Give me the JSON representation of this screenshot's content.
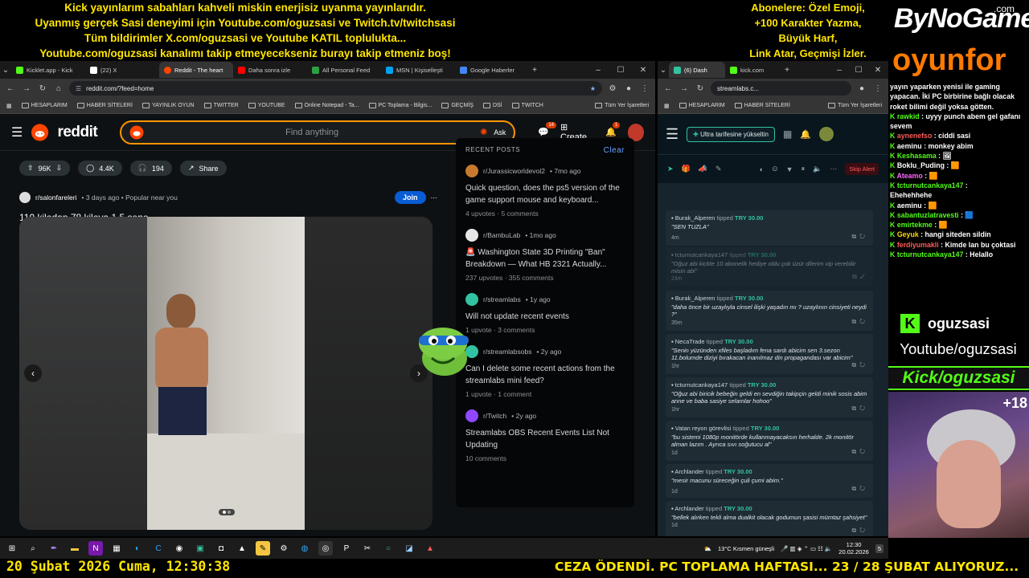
{
  "overlay": {
    "top_lines": [
      "Kick yayınlarım sabahları kahveli miskin enerjisiz uyanma yayınlarıdır.",
      "Uyanmış gerçek Sasi deneyimi için Youtube.com/oguzsasi ve Twitch.tv/twitchsasi",
      "Tüm bildirimler X.com/oguzsasi ve Youtube KATIL toplulukta...",
      "Youtube.com/oguzsasi kanalımı takip etmeyecekseniz burayı takip etmeniz boş!"
    ],
    "right_lines": [
      "Abonelere: Özel Emoji,",
      "+100 Karakter Yazma,",
      "Büyük Harf,",
      "Link Atar, Geçmişi İzler."
    ],
    "brand_top": "ByNoGame",
    "brand_com": ".com",
    "brand_bottom": "oyunfor",
    "kick_channel": "oguzsasi",
    "youtube_label": "Youtube/oguzsasi",
    "kick_label": "Kick/oguzsasi",
    "viewer_plus": "+18",
    "bottom_date": "20 Şubat 2026 Cuma, 12:30:38",
    "bottom_ticker": "CEZA ÖDENDİ. PC TOPLAMA HAFTASI... 23 / 28 ŞUBAT ALIYORUZ..."
  },
  "left_browser": {
    "tabs": [
      {
        "label": "Kicklet.app - Kick",
        "color": "#53fc18"
      },
      {
        "label": "(22) X",
        "color": "#ffffff"
      },
      {
        "label": "Reddit - The heart",
        "color": "#ff4500",
        "active": true
      },
      {
        "label": "Daha sonra izle",
        "color": "#ff0000"
      },
      {
        "label": "All Personal Feed",
        "color": "#2ea043"
      },
      {
        "label": "MSN | Kişiselleşti",
        "color": "#00a2ed"
      },
      {
        "label": "Google Haberler",
        "color": "#4285f4"
      }
    ],
    "url": "reddit.com/?feed=home",
    "bookmarks": [
      "HESAPLARIM",
      "HABER SİTELERİ",
      "YAYINLIK OYUN",
      "TWITTER",
      "YOUTUBE",
      "Online Notepad - Ta...",
      "PC Toplama - Bilgis...",
      "GEÇMİŞ",
      "DSİ",
      "TWITCH",
      "Tüm Yer İşaretleri"
    ]
  },
  "reddit": {
    "logo": "reddit",
    "search_placeholder": "Find anything",
    "ask": "Ask",
    "chat_badge": "14",
    "create": "Create",
    "notif_badge": "1",
    "vote_count": "96K",
    "comments": "4.4K",
    "awards": "194",
    "share": "Share",
    "subreddit": "r/salonfareleri",
    "post_meta": "• 3 days ago • Popular near you",
    "join": "Join",
    "post_title": "110 kilodan 78 kiloya 1.5 sene",
    "recent_header": "RECENT POSTS",
    "clear": "Clear",
    "recent_posts": [
      {
        "sub": "r/Jurassicworldevol2",
        "age": "• 7mo ago",
        "title": "Quick question, does the ps5 version of the game support mouse and keyboard...",
        "upvotes": "4 upvotes",
        "comments": "5 comments",
        "color": "#c77a2e"
      },
      {
        "sub": "r/BambuLab",
        "age": "• 1mo ago",
        "title": "🚨 Washington State 3D Printing \"Ban\" Breakdown — What HB 2321 Actually...",
        "upvotes": "237 upvotes",
        "comments": "355 comments",
        "color": "#e6e6e6"
      },
      {
        "sub": "r/streamlabs",
        "age": "• 1y ago",
        "title": "Will not update recent events",
        "upvotes": "1 upvote",
        "comments": "3 comments",
        "color": "#31c3a2"
      },
      {
        "sub": "r/streamlabsobs",
        "age": "• 2y ago",
        "title": "Can I delete some recent actions from the streamlabs mini feed?",
        "upvotes": "1 upvote",
        "comments": "1 comment",
        "color": "#31c3a2"
      },
      {
        "sub": "r/Twitch",
        "age": "• 2y ago",
        "title": "Streamlabs OBS Recent Events List Not Updating",
        "upvotes": "",
        "comments": "10 comments",
        "color": "#9146ff"
      }
    ]
  },
  "right_browser": {
    "tabs": [
      {
        "label": "(6) Dash",
        "color": "#31c3a2"
      },
      {
        "label": "kick.com",
        "color": "#53fc18"
      }
    ],
    "url": "streamlabs.c...",
    "bookmarks": [
      "HESAPLARIM",
      "HABER SİTELERİ",
      "Tüm Yer İşaretleri"
    ]
  },
  "streamlabs": {
    "upgrade": "Ultra tarifesine yükseltin",
    "skip_alert": "Skip Alert",
    "events": [
      {
        "name": "Burak_Alperen",
        "tipped": "tipped",
        "amount": "TRY 30.00",
        "msg": "\"SEN TUZLA\"",
        "ago": "4m",
        "dim": false
      },
      {
        "name": "tcturnutcankaya147",
        "tipped": "tipped",
        "amount": "TRY 30.00",
        "msg": "\"Oğuz abi kickte 10 abonelik hediye oldu çok üzür dilerim vip verebilir misin abi\"",
        "ago": "24m",
        "dim": true
      },
      {
        "name": "Burak_Alperen",
        "tipped": "tipped",
        "amount": "TRY 30.00",
        "msg": "\"daha önce bir uzaylıyla cinsel ilişki yaşadın mı ? uzaylının cinsiyeti neydi ?\"",
        "ago": "35m",
        "dim": false
      },
      {
        "name": "NecaTrade",
        "tipped": "tipped",
        "amount": "TRY 30.00",
        "msg": "\"Senin yüzünden xfiles başladım fena sardı abicim sen 3.sezon 11.bolumde diziyi bırakacan inanılmaz din propagandası var abicim\"",
        "ago": "1hr",
        "dim": false
      },
      {
        "name": "tcturnutcankaya147",
        "tipped": "tipped",
        "amount": "TRY 30.00",
        "msg": "\"Oğuz abi biricik bebeğin geldi en sevdiğin takipçin geldi minik sosis abim anne ve baba sasiye selamlar hohoo\"",
        "ago": "1hr",
        "dim": false
      },
      {
        "name": "Vatan reyon görevlisi",
        "tipped": "tipped",
        "amount": "TRY 30.00",
        "msg": "\"bu sistemi 1080p monitörde kullanmayacaksın herhalde. 2k monitör alman lazım . Ayrıca sıvı soğutucu al\"",
        "ago": "1d",
        "dim": false
      },
      {
        "name": "Archlander",
        "tipped": "tipped",
        "amount": "TRY 30.00",
        "msg": "\"mesir macunu süreceğin çuli çumi abim.\"",
        "ago": "1d",
        "dim": false
      },
      {
        "name": "Archlander",
        "tipped": "tipped",
        "amount": "TRY 30.00",
        "msg": "\"bellek alırken tekli alma dualkit olacak godumun şasisi mümtaz şahsiyet\"",
        "ago": "1d",
        "dim": false
      }
    ]
  },
  "chat": [
    {
      "user": "",
      "text": "yayın yaparken yenisi ile gaming",
      "color": "#fff"
    },
    {
      "user": "",
      "text": "yapacan. İki PC birbirine bağlı olacak",
      "color": "#fff"
    },
    {
      "user": "",
      "text": "roket bilimi değil yoksa götten.",
      "color": "#fff"
    },
    {
      "user": "rawkid",
      "text": ": uyyy punch abem gel gafanı",
      "color": "#53fc18"
    },
    {
      "user": "",
      "text": "sevem",
      "color": "#fff"
    },
    {
      "user": "aynenefso",
      "text": ": ciddi sasi",
      "color": "#ff5a5a"
    },
    {
      "user": "aeminu",
      "text": ": monkey abim",
      "color": "#ffffff"
    },
    {
      "user": "Keshasama",
      "text": ": 🖼",
      "color": "#53fc18"
    },
    {
      "user": "Boklu_Puding",
      "text": ": 🟧",
      "color": "#ffffff"
    },
    {
      "user": "Ateamo",
      "text": ": 🟧",
      "color": "#ff66ff"
    },
    {
      "user": "tcturnutcankaya147",
      "text": ":",
      "color": "#53fc18"
    },
    {
      "user": "",
      "text": "Ehehehhehe",
      "color": "#fff"
    },
    {
      "user": "aeminu",
      "text": ": 🟧",
      "color": "#ffffff"
    },
    {
      "user": "sabantuzlatravesti",
      "text": ": 🟦",
      "color": "#53fc18"
    },
    {
      "user": "emirtekme",
      "text": ": 🟧",
      "color": "#53fc18"
    },
    {
      "user": "Geyuk",
      "text": ": hangi siteden sildin",
      "color": "#ffd700"
    },
    {
      "user": "ferdiyumakli",
      "text": ": Kimde lan bu çoktasi",
      "color": "#ff5a5a"
    },
    {
      "user": "tcturnutcankaya147",
      "text": ": Helallo",
      "color": "#53fc18"
    }
  ],
  "taskbar": {
    "weather": "13°C  Kısmen güneşli",
    "time": "12:30",
    "date": "20.02.2026",
    "notif": "5"
  }
}
